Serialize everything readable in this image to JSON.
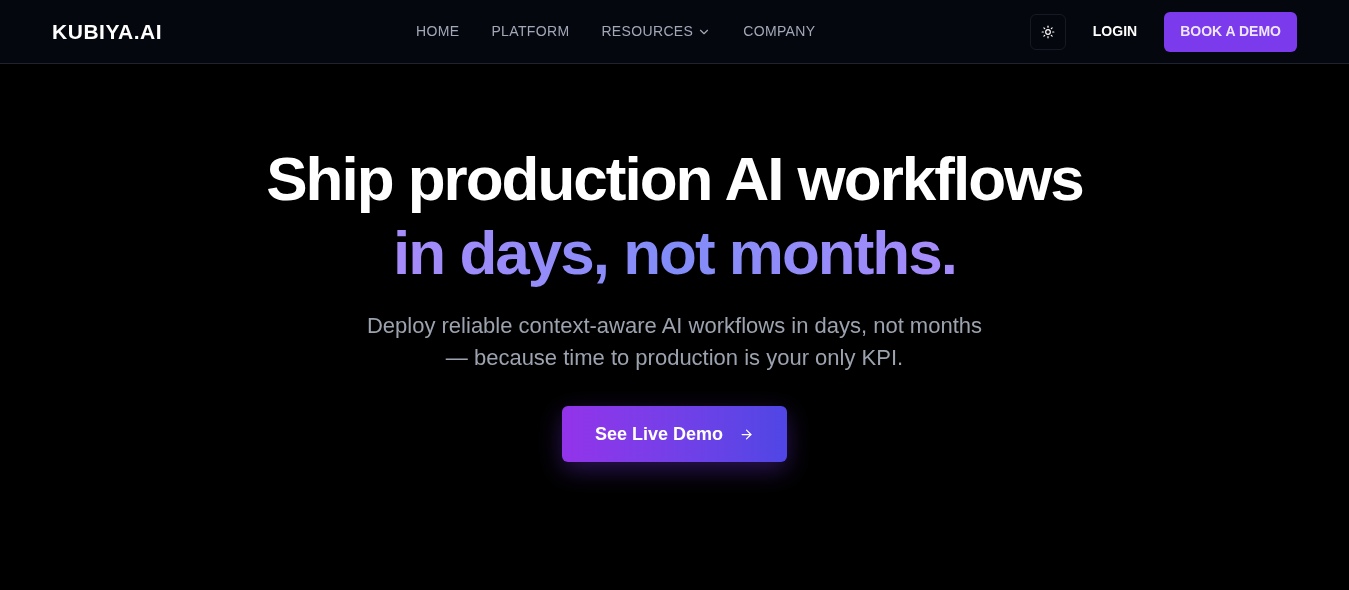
{
  "header": {
    "logo": "KUBIYA.AI",
    "nav": [
      {
        "label": "HOME",
        "has_menu": false
      },
      {
        "label": "PLATFORM",
        "has_menu": false
      },
      {
        "label": "RESOURCES",
        "has_menu": true
      },
      {
        "label": "COMPANY",
        "has_menu": false
      }
    ],
    "login": "LOGIN",
    "cta": "BOOK A DEMO"
  },
  "hero": {
    "title_line_1": "Ship production AI workflows",
    "title_line_2": "in days, not months.",
    "subtitle_line_1": "Deploy reliable context-aware AI workflows in days, not months",
    "subtitle_line_2": "— because time to production is your only KPI.",
    "button": "See Live Demo"
  }
}
